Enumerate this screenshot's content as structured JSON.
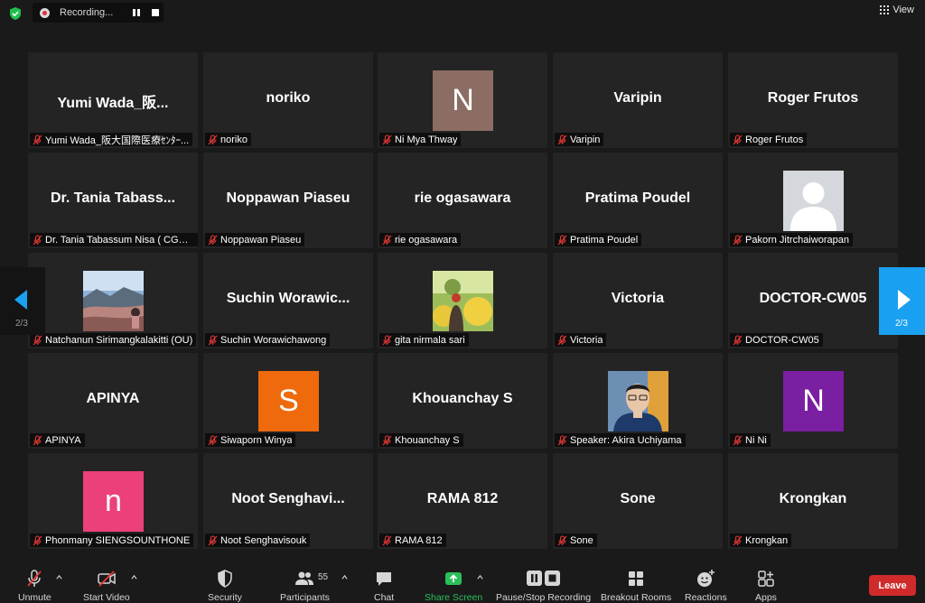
{
  "recording": {
    "text": "Recording..."
  },
  "view": {
    "label": "View"
  },
  "pagination": {
    "left": "2/3",
    "right": "2/3"
  },
  "tiles": [
    {
      "display": "Yumi  Wada_阪...",
      "label": "Yumi Wada_阪大国際医療ｾﾝﾀｰ..."
    },
    {
      "display": "noriko",
      "label": "noriko"
    },
    {
      "avatar_letter": "N",
      "avatar_color": "#8b6d63",
      "label": "Ni Mya Thway"
    },
    {
      "display": "Varipin",
      "label": "Varipin"
    },
    {
      "display": "Roger Frutos",
      "label": "Roger Frutos"
    },
    {
      "display": "Dr.  Tania  Tabass...",
      "label": "Dr. Tania Tabassum Nisa ( CGH, Ja..."
    },
    {
      "display": "Noppawan Piaseu",
      "label": "Noppawan Piaseu"
    },
    {
      "display": "rie ogasawara",
      "label": "rie ogasawara"
    },
    {
      "display": "Pratima Poudel",
      "label": "Pratima Poudel"
    },
    {
      "photo": "default-user",
      "label": "Pakorn Jitrchaiworapan"
    },
    {
      "photo": "landscape",
      "label": "Natchanun Sirimangkalakitti (OU)"
    },
    {
      "display": "Suchin  Worawic...",
      "label": "Suchin Worawichawong"
    },
    {
      "photo": "garden-person",
      "label": "gita nirmala sari"
    },
    {
      "display": "Victoria",
      "label": "Victoria"
    },
    {
      "display": "DOCTOR-CW05",
      "label": "DOCTOR-CW05"
    },
    {
      "display": "APINYA",
      "label": "APINYA"
    },
    {
      "avatar_letter": "S",
      "avatar_color": "#ee6a0d",
      "label": "Siwaporn Winya"
    },
    {
      "display": "Khouanchay S",
      "label": "Khouanchay S"
    },
    {
      "photo": "man-glasses",
      "label": "Speaker: Akira Uchiyama"
    },
    {
      "avatar_letter": "N",
      "avatar_color": "#7b1fa2",
      "label": "Ni Ni"
    },
    {
      "avatar_letter": "n",
      "avatar_color": "#ec407a",
      "label": "Phonmany SIENGSOUNTHONE"
    },
    {
      "display": "Noot  Senghavi...",
      "label": "Noot Senghavisouk"
    },
    {
      "display": "RAMA 812",
      "label": "RAMA 812"
    },
    {
      "display": "Sone",
      "label": "Sone"
    },
    {
      "display": "Krongkan",
      "label": "Krongkan"
    }
  ],
  "toolbar": {
    "unmute": "Unmute",
    "start_video": "Start Video",
    "security": "Security",
    "participants": "Participants",
    "participants_count": "55",
    "chat": "Chat",
    "share_screen": "Share Screen",
    "recording": "Pause/Stop Recording",
    "breakout": "Breakout Rooms",
    "reactions": "Reactions",
    "apps": "Apps",
    "leave": "Leave"
  },
  "colors": {
    "accent": "#1aa0f0",
    "share": "#2bbf5a",
    "leave": "#d12a2a"
  }
}
